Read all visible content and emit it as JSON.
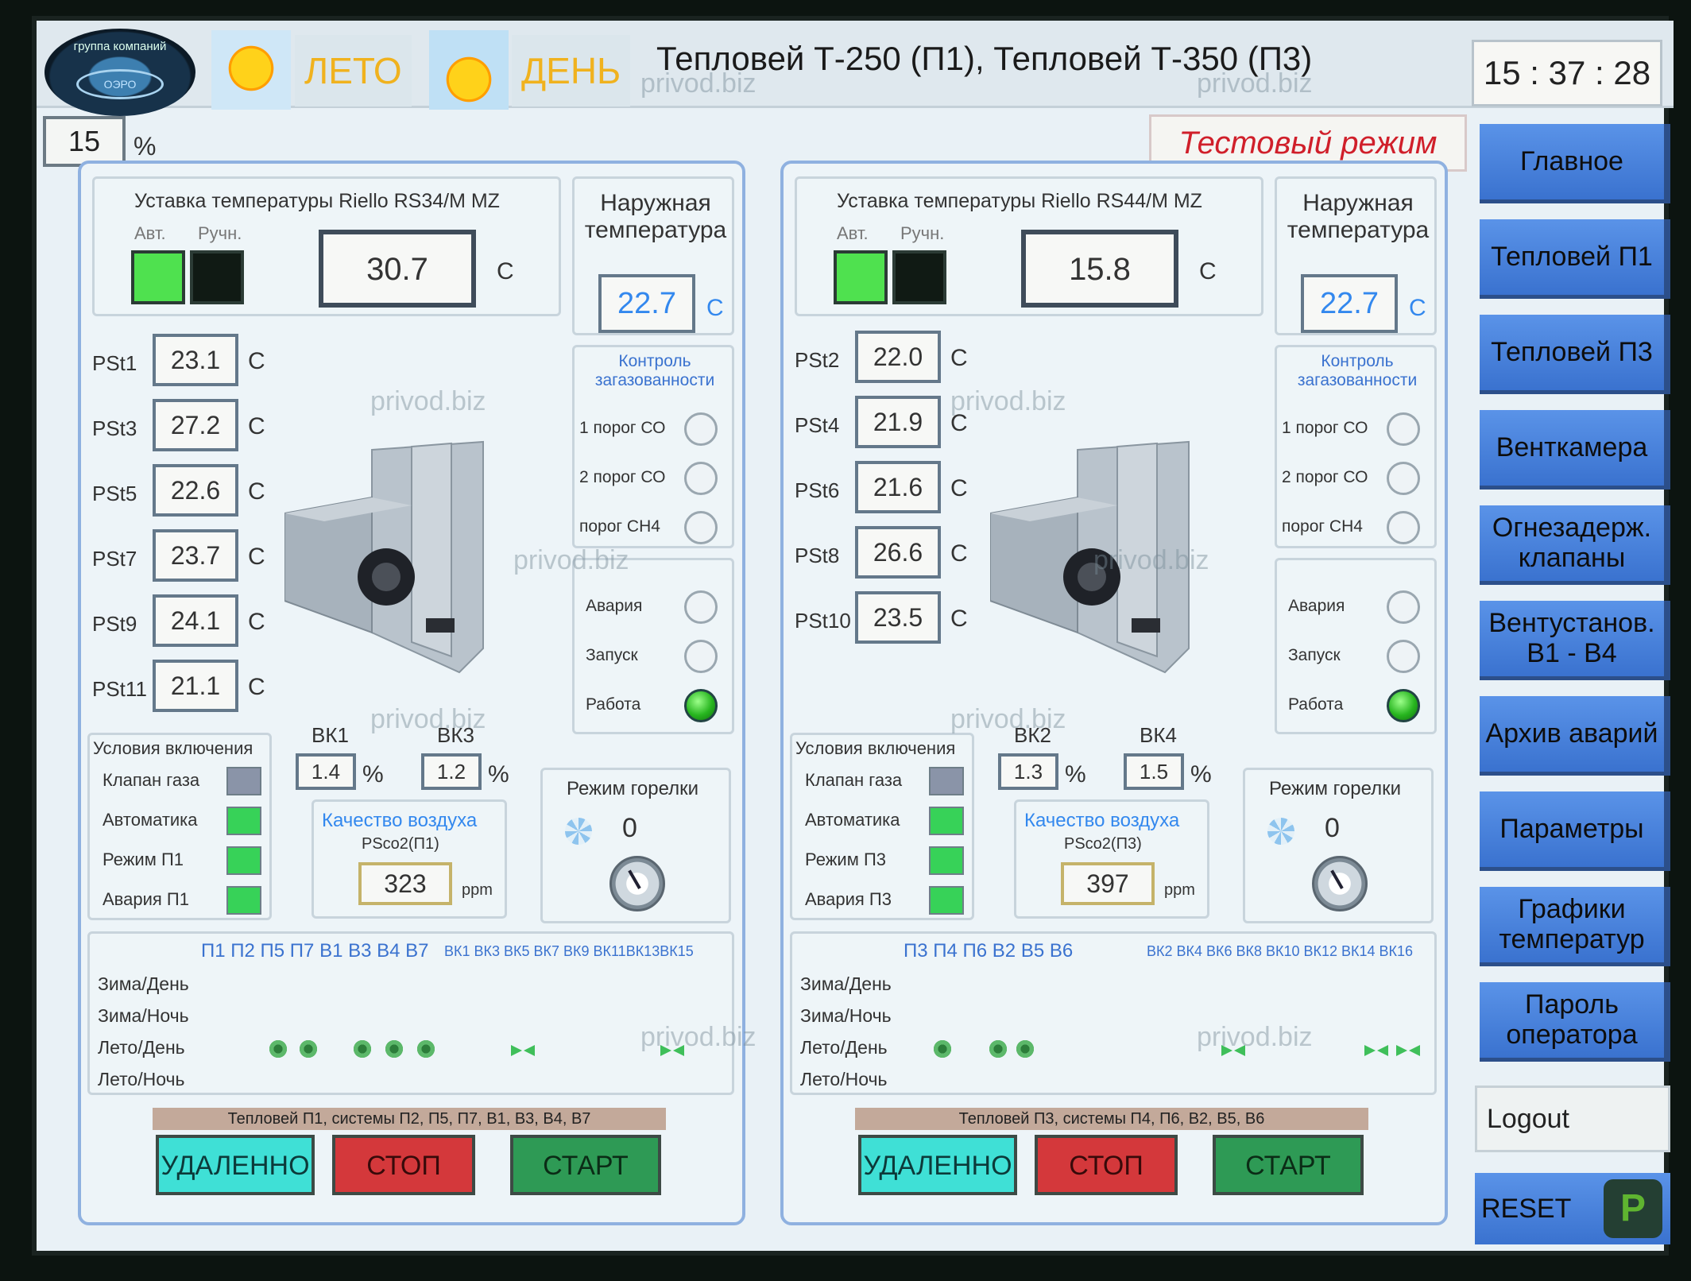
{
  "header": {
    "logo_text": "группа компаний",
    "logo_brand": "ОЭРО",
    "season": "ЛЕТО",
    "daytime": "ДЕНЬ",
    "title": "Тепловей Т-250 (П1), Тепловей Т-350 (П3)",
    "clock": "15 : 37 : 28"
  },
  "top": {
    "percent_value": "15",
    "percent_unit": "%",
    "test_mode": "Тестовый режим"
  },
  "nav": [
    "Главное",
    "Тепловей П1",
    "Тепловей П3",
    "Венткамера",
    "Огнезадерж. клапаны",
    "Вентустанов. В1 - В4",
    "Архив аварий",
    "Параметры",
    "Графики температур",
    "Пароль оператора"
  ],
  "logout": "Logout",
  "reset": "RESET",
  "reset_badge": "P",
  "common": {
    "unit_c": "C",
    "unit_pct": "%",
    "unit_ppm": "ppm",
    "auto": "Авт.",
    "manual": "Ручн.",
    "outside_temp_title": "Наружная температура",
    "gas_title": "Контроль загазованности",
    "gas_co1": "1 порог СО",
    "gas_co2": "2 порог СО",
    "gas_ch4": "порог СН4",
    "alarm": "Авария",
    "launch": "Запуск",
    "work": "Работа",
    "conditions_title": "Условия включения",
    "gas_valve": "Клапан газа",
    "automation": "Автоматика",
    "air_quality": "Качество воздуха",
    "burner_mode": "Режим горелки",
    "burner_value": "0",
    "mode_winter_day": "Зима/День",
    "mode_winter_night": "Зима/Ночь",
    "mode_summer_day": "Лето/День",
    "mode_summer_night": "Лето/Ночь",
    "btn_remote": "УДАЛЕННО",
    "btn_stop": "СТОП",
    "btn_start": "СТАРТ",
    "watermark": "privod.biz"
  },
  "p1": {
    "setpoint_title": "Уставка температуры Riello RS34/M MZ",
    "setpoint": "30.7",
    "outside_temp": "22.7",
    "sensors": [
      {
        "name": "PSt1",
        "value": "23.1"
      },
      {
        "name": "PSt3",
        "value": "27.2"
      },
      {
        "name": "PSt5",
        "value": "22.6"
      },
      {
        "name": "PSt7",
        "value": "23.7"
      },
      {
        "name": "PSt9",
        "value": "24.1"
      },
      {
        "name": "PSt11",
        "value": "21.1"
      }
    ],
    "vk_a": {
      "name": "ВК1",
      "value": "1.4"
    },
    "vk_b": {
      "name": "ВК3",
      "value": "1.2"
    },
    "mode_label": "Режим П1",
    "alarm_label": "Авария П1",
    "co2_label": "PSco2(П1)",
    "co2": "323",
    "sys_head": "П1 П2 П5 П7 В1 В3 В4 В7",
    "sys_vk": "ВК1 ВК3 ВК5 ВК7 ВК9 ВК11ВК13ВК15",
    "strip": "Тепловей П1, системы П2, П5, П7, В1, В3, В4, В7"
  },
  "p3": {
    "setpoint_title": "Уставка температуры Riello RS44/M MZ",
    "setpoint": "15.8",
    "outside_temp": "22.7",
    "sensors": [
      {
        "name": "PSt2",
        "value": "22.0"
      },
      {
        "name": "PSt4",
        "value": "21.9"
      },
      {
        "name": "PSt6",
        "value": "21.6"
      },
      {
        "name": "PSt8",
        "value": "26.6"
      },
      {
        "name": "PSt10",
        "value": "23.5"
      }
    ],
    "vk_a": {
      "name": "ВК2",
      "value": "1.3"
    },
    "vk_b": {
      "name": "ВК4",
      "value": "1.5"
    },
    "mode_label": "Режим П3",
    "alarm_label": "Авария П3",
    "co2_label": "PSco2(П3)",
    "co2": "397",
    "sys_head": "П3 П4 П6 В2 В5 В6",
    "sys_vk": "ВК2 ВК4 ВК6 ВК8 ВК10 ВК12 ВК14 ВК16",
    "strip": "Тепловей П3, системы П4, П6, В2, В5, В6"
  }
}
